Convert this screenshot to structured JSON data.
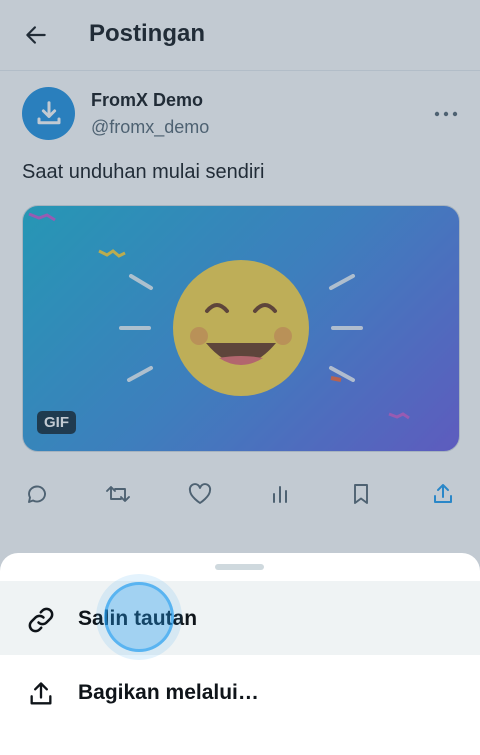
{
  "header": {
    "title": "Postingan"
  },
  "post": {
    "author_name": "FromX Demo",
    "author_handle": "@fromx_demo",
    "text": "Saat unduhan mulai sendiri",
    "media_badge": "GIF"
  },
  "actions": [
    "reply-icon",
    "repost-icon",
    "like-icon",
    "views-icon",
    "bookmark-icon",
    "share-icon"
  ],
  "sheet": {
    "items": [
      {
        "label": "Salin tautan",
        "icon": "link-icon"
      },
      {
        "label": "Bagikan melalui…",
        "icon": "share-icon"
      }
    ]
  },
  "colors": {
    "accent": "#1d9bf0",
    "text": "#0f1419",
    "muted": "#536471"
  }
}
